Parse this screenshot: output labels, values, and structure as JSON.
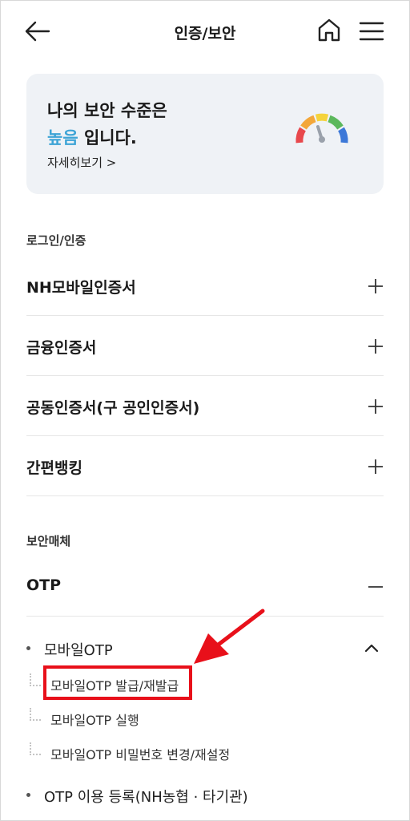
{
  "header": {
    "title": "인증/보안"
  },
  "security_card": {
    "line1": "나의 보안 수준은",
    "level": "높음",
    "line2_suffix": " 입니다.",
    "detail_link": "자세히보기 >",
    "gauge_level": "high",
    "gauge_colors": [
      "#e8484c",
      "#f3a73a",
      "#f5d33b",
      "#5cb85c",
      "#3c78d8"
    ]
  },
  "login_section": {
    "label": "로그인/인증",
    "items": [
      {
        "label": "NH모바일인증서",
        "state": "collapsed"
      },
      {
        "label": "금융인증서",
        "state": "collapsed"
      },
      {
        "label": "공동인증서(구 공인인증서)",
        "state": "collapsed"
      },
      {
        "label": "간편뱅킹",
        "state": "collapsed"
      }
    ]
  },
  "security_media_section": {
    "label": "보안매체",
    "otp": {
      "label": "OTP",
      "state": "expanded",
      "mobile_otp": {
        "label": "모바일OTP",
        "state": "expanded",
        "sub_items": [
          {
            "label": "모바일OTP 발급/재발급",
            "highlighted": true
          },
          {
            "label": "모바일OTP 실행"
          },
          {
            "label": "모바일OTP 비밀번호 변경/재설정"
          }
        ]
      },
      "otp_register": {
        "label": "OTP 이용 등록(NH농협 · 타기관)"
      }
    }
  },
  "annotation": {
    "highlight_color": "#e8101a"
  }
}
